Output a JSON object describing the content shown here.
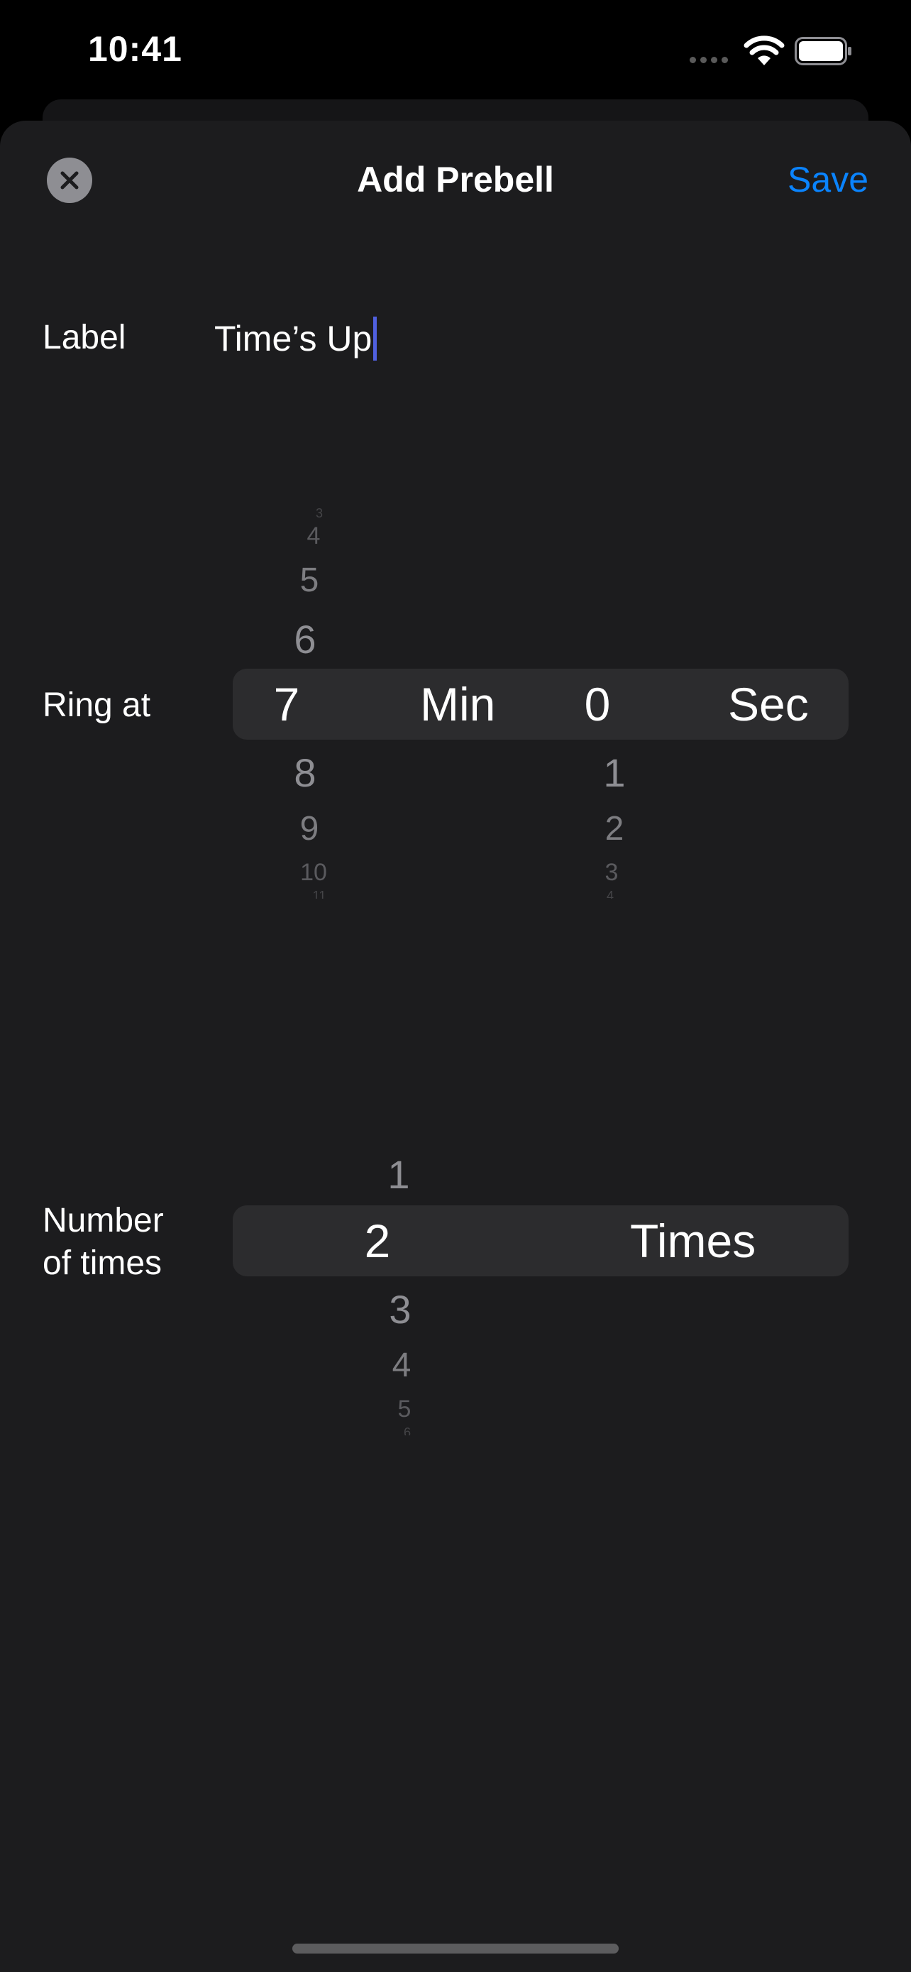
{
  "status": {
    "time": "10:41"
  },
  "header": {
    "title": "Add Prebell",
    "save_label": "Save"
  },
  "label_row": {
    "label": "Label",
    "value": "Time’s Up"
  },
  "ring_at": {
    "label": "Ring at",
    "minutes": {
      "selected": "7",
      "above": [
        "3",
        "4",
        "5",
        "6"
      ],
      "below": [
        "8",
        "9",
        "10",
        "11"
      ],
      "unit": "Min"
    },
    "seconds": {
      "selected": "0",
      "below": [
        "1",
        "2",
        "3",
        "4"
      ],
      "unit": "Sec"
    }
  },
  "times_row": {
    "label_line1": "Number",
    "label_line2": "of times",
    "picker": {
      "selected": "2",
      "above": [
        "1"
      ],
      "below": [
        "3",
        "4",
        "5",
        "6"
      ],
      "unit": "Times"
    }
  },
  "colors": {
    "accent": "#0a84ff",
    "sheet": "#1c1c1e",
    "picker_band": "#2c2c2e",
    "caret": "#5060e0"
  }
}
